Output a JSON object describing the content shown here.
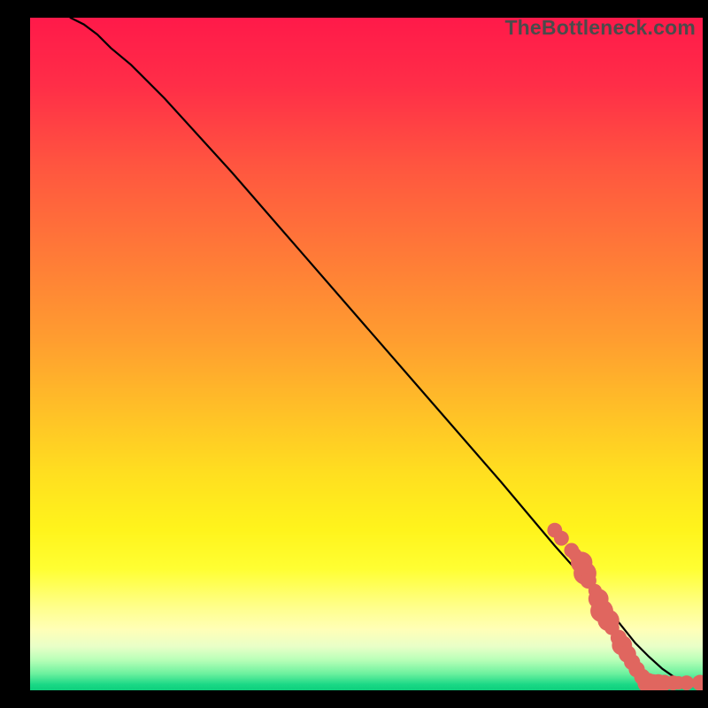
{
  "watermark": "TheBottleneck.com",
  "gradient": {
    "stops": [
      {
        "offset": 0.0,
        "color": "#ff1a4a"
      },
      {
        "offset": 0.1,
        "color": "#ff2e48"
      },
      {
        "offset": 0.22,
        "color": "#ff5640"
      },
      {
        "offset": 0.35,
        "color": "#ff7a38"
      },
      {
        "offset": 0.48,
        "color": "#ff9e30"
      },
      {
        "offset": 0.58,
        "color": "#ffbf28"
      },
      {
        "offset": 0.68,
        "color": "#ffe020"
      },
      {
        "offset": 0.76,
        "color": "#fff41c"
      },
      {
        "offset": 0.82,
        "color": "#ffff33"
      },
      {
        "offset": 0.875,
        "color": "#ffff8a"
      },
      {
        "offset": 0.91,
        "color": "#ffffb8"
      },
      {
        "offset": 0.935,
        "color": "#e9ffc8"
      },
      {
        "offset": 0.955,
        "color": "#b8ffb8"
      },
      {
        "offset": 0.975,
        "color": "#6ef29f"
      },
      {
        "offset": 0.992,
        "color": "#18d885"
      },
      {
        "offset": 1.0,
        "color": "#0fcf7d"
      }
    ]
  },
  "chart_data": {
    "type": "line",
    "title": "",
    "xlabel": "",
    "ylabel": "",
    "xlim": [
      0,
      100
    ],
    "ylim": [
      0,
      100
    ],
    "series": [
      {
        "name": "curve",
        "x": [
          6,
          8,
          10,
          12,
          15,
          20,
          30,
          40,
          50,
          60,
          70,
          78,
          82,
          86,
          88,
          90,
          92,
          94,
          96,
          98,
          100
        ],
        "y": [
          100,
          99,
          97.5,
          95.5,
          93,
          88,
          77,
          65.5,
          54,
          42.5,
          31,
          21.5,
          17,
          12,
          9.5,
          7,
          5,
          3.2,
          1.8,
          1.0,
          1.0
        ]
      }
    ],
    "markers": {
      "name": "highlighted-points",
      "color": "#e0665f",
      "points": [
        {
          "x": 78,
          "y": 23.8,
          "r": 1.1
        },
        {
          "x": 79,
          "y": 22.6,
          "r": 1.1
        },
        {
          "x": 80.5,
          "y": 20.8,
          "r": 1.1
        },
        {
          "x": 81,
          "y": 20.2,
          "r": 1.0
        },
        {
          "x": 82,
          "y": 19.0,
          "r": 1.6
        },
        {
          "x": 82.5,
          "y": 17.4,
          "r": 1.7
        },
        {
          "x": 83,
          "y": 16.3,
          "r": 1.2
        },
        {
          "x": 84,
          "y": 14.8,
          "r": 1.0
        },
        {
          "x": 84.5,
          "y": 13.6,
          "r": 1.5
        },
        {
          "x": 85,
          "y": 11.8,
          "r": 1.7
        },
        {
          "x": 86,
          "y": 10.4,
          "r": 1.6
        },
        {
          "x": 86.5,
          "y": 9.3,
          "r": 1.1
        },
        {
          "x": 87.5,
          "y": 7.8,
          "r": 1.2
        },
        {
          "x": 88,
          "y": 6.7,
          "r": 1.5
        },
        {
          "x": 88.8,
          "y": 5.4,
          "r": 1.3
        },
        {
          "x": 89.5,
          "y": 4.2,
          "r": 1.2
        },
        {
          "x": 90.2,
          "y": 3.1,
          "r": 1.2
        },
        {
          "x": 91,
          "y": 2.0,
          "r": 1.2
        },
        {
          "x": 91.8,
          "y": 1.1,
          "r": 1.5
        },
        {
          "x": 92.6,
          "y": 1.1,
          "r": 1.3
        },
        {
          "x": 93.4,
          "y": 1.1,
          "r": 1.3
        },
        {
          "x": 94.3,
          "y": 1.1,
          "r": 1.2
        },
        {
          "x": 95.6,
          "y": 1.1,
          "r": 1.1
        },
        {
          "x": 96.4,
          "y": 1.1,
          "r": 1.0
        },
        {
          "x": 97.6,
          "y": 1.1,
          "r": 1.1
        },
        {
          "x": 99.6,
          "y": 1.1,
          "r": 1.2
        },
        {
          "x": 100.3,
          "y": 1.1,
          "r": 1.0
        }
      ]
    }
  }
}
